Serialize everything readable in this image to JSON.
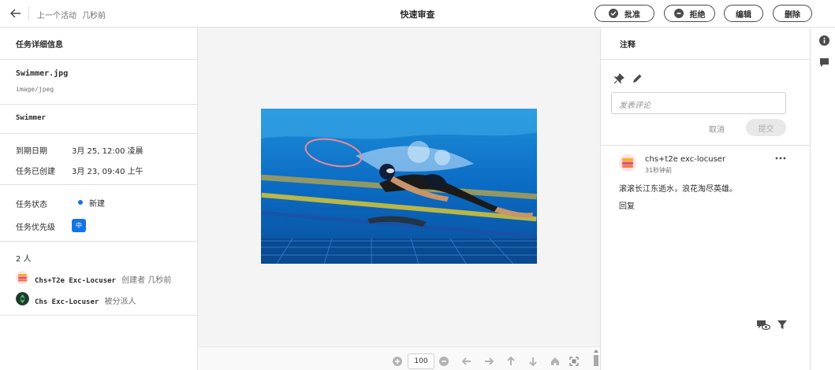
{
  "topbar": {
    "last_activity_label": "上一个活动",
    "last_activity_time": "几秒前",
    "title": "快速审查",
    "approve_label": "批准",
    "reject_label": "拒绝",
    "edit_label": "编辑",
    "delete_label": "删除"
  },
  "task_details": {
    "header": "任务详细信息",
    "file_name": "Swimmer.jpg",
    "file_type": "image/jpeg",
    "title": "Swimmer",
    "due_date_label": "到期日期",
    "due_date_value": "3月 25, 12:00 凌晨",
    "created_label": "任务已创建",
    "created_value": "3月 23, 09:40 上午",
    "status_label": "任务状态",
    "status_value": "新建",
    "priority_label": "任务优先级",
    "priority_value": "中",
    "people_count": "2 人",
    "people": [
      {
        "name": "Chs+T2e Exc-Locuser",
        "role": "创建者 几秒前"
      },
      {
        "name": "Chs Exc-Locuser",
        "role": "被分派人"
      }
    ]
  },
  "viewer": {
    "zoom_value": "100"
  },
  "annotations": {
    "header": "注释",
    "comment_placeholder": "发表评论",
    "cancel_label": "取消",
    "submit_label": "提交",
    "comment": {
      "author": "chs+t2e exc-locuser",
      "time": "31秒钟前",
      "text": "滚滚长江东逝水，浪花淘尽英雄。",
      "reply_label": "回复"
    }
  },
  "colors": {
    "accent": "#1473e6",
    "annotation_stroke": "#e88a9a"
  }
}
